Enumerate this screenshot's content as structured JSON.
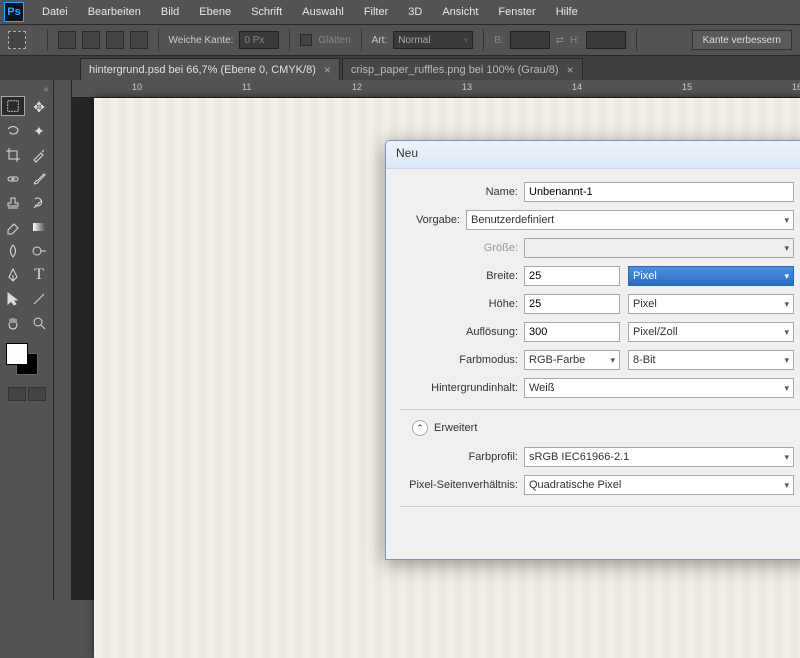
{
  "menubar": {
    "items": [
      "Datei",
      "Bearbeiten",
      "Bild",
      "Ebene",
      "Schrift",
      "Auswahl",
      "Filter",
      "3D",
      "Ansicht",
      "Fenster",
      "Hilfe"
    ]
  },
  "options": {
    "weiche_label": "Weiche Kante:",
    "weiche_value": "0 Px",
    "glaetten": "Glätten",
    "art": "Art:",
    "art_value": "Normal",
    "b": "B:",
    "h": "H:",
    "kante_btn": "Kante verbessern"
  },
  "tabs": [
    {
      "label": "hintergrund.psd bei 66,7% (Ebene 0, CMYK/8)"
    },
    {
      "label": "crisp_paper_ruffles.png bei 100% (Grau/8)"
    }
  ],
  "ruler": {
    "ticks": [
      "10",
      "11",
      "12",
      "13",
      "14",
      "15",
      "16"
    ]
  },
  "dialog": {
    "title": "Neu",
    "name_label": "Name:",
    "name_value": "Unbenannt-1",
    "vorgabe_label": "Vorgabe:",
    "vorgabe_value": "Benutzerdefiniert",
    "groesse_label": "Größe:",
    "breite_label": "Breite:",
    "breite_value": "25",
    "breite_unit": "Pixel",
    "hoehe_label": "Höhe:",
    "hoehe_value": "25",
    "hoehe_unit": "Pixel",
    "aufl_label": "Auflösung:",
    "aufl_value": "300",
    "aufl_unit": "Pixel/Zoll",
    "farbmodus_label": "Farbmodus:",
    "farbmodus_value": "RGB-Farbe",
    "farbmodus_depth": "8-Bit",
    "hinhalt_label": "Hintergrundinhalt:",
    "hinhalt_value": "Weiß",
    "erweitert": "Erweitert",
    "farbprofil_label": "Farbprofil:",
    "farbprofil_value": "sRGB IEC61966-2.1",
    "pixelsv_label": "Pixel-Seitenverhältnis:",
    "pixelsv_value": "Quadratische Pixel"
  }
}
